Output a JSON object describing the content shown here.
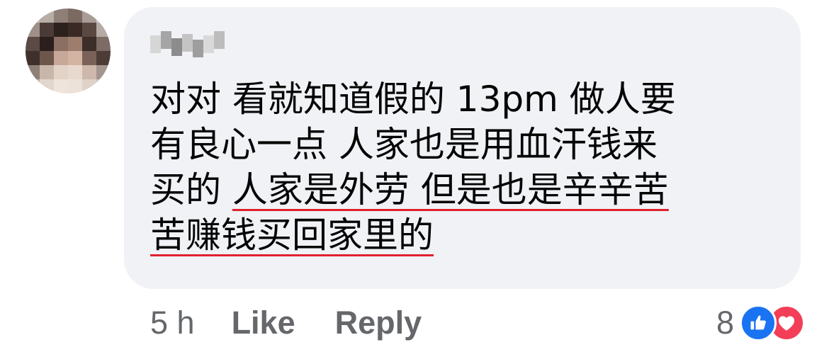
{
  "comment": {
    "text_lines": [
      {
        "plain": "对对 看就知道假的 13pm 做人要",
        "underlined": ""
      },
      {
        "plain": "有良心一点 人家也是用血汗钱来",
        "underlined": ""
      },
      {
        "plain": "买的 ",
        "underlined": "人家是外劳 但是也是辛辛苦"
      },
      {
        "plain": "",
        "underlined": "苦赚钱买回家里的"
      }
    ],
    "underline_color": "#e0212e"
  },
  "footer": {
    "time": "5 h",
    "like_label": "Like",
    "reply_label": "Reply"
  },
  "reactions": {
    "count": "8",
    "icons": [
      "thumbs-up-icon",
      "heart-icon"
    ],
    "like_color": "#1a74f2",
    "love_color": "#f33e58"
  },
  "colors": {
    "bubble": "#f0f2f5",
    "text": "#050505",
    "secondary_text": "#65676b"
  }
}
